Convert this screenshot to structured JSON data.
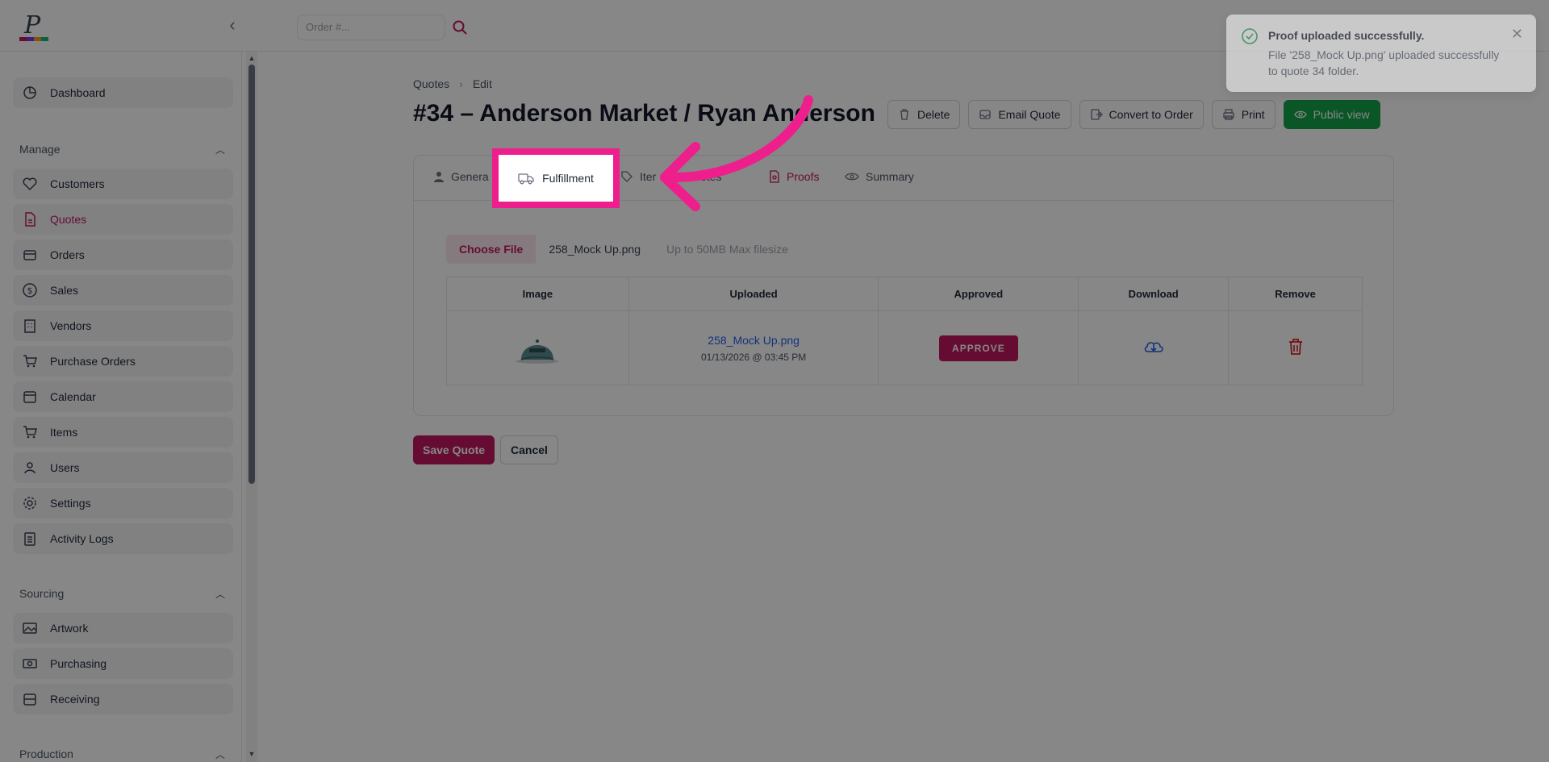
{
  "header": {
    "search_placeholder": "Order #..."
  },
  "sidebar": {
    "items_top": [
      {
        "label": "Dashboard",
        "icon": "dashboard-icon"
      }
    ],
    "manage_section": "Manage",
    "manage_items": [
      {
        "label": "Customers",
        "icon": "heart-icon"
      },
      {
        "label": "Quotes",
        "icon": "document-icon",
        "active": true
      },
      {
        "label": "Orders",
        "icon": "box-icon"
      },
      {
        "label": "Sales",
        "icon": "dollar-icon"
      },
      {
        "label": "Vendors",
        "icon": "building-icon"
      },
      {
        "label": "Purchase Orders",
        "icon": "cart-icon"
      },
      {
        "label": "Calendar",
        "icon": "calendar-icon"
      },
      {
        "label": "Items",
        "icon": "cart-icon"
      },
      {
        "label": "Users",
        "icon": "users-icon"
      },
      {
        "label": "Settings",
        "icon": "gear-icon"
      },
      {
        "label": "Activity Logs",
        "icon": "clipboard-icon"
      }
    ],
    "sourcing_section": "Sourcing",
    "sourcing_items": [
      {
        "label": "Artwork",
        "icon": "image-icon"
      },
      {
        "label": "Purchasing",
        "icon": "money-icon"
      },
      {
        "label": "Receiving",
        "icon": "inbox-icon"
      }
    ],
    "production_section": "Production"
  },
  "breadcrumb": {
    "parent": "Quotes",
    "current": "Edit"
  },
  "page_title": "#34 – Anderson Market / Ryan Anderson",
  "actions": {
    "delete": "Delete",
    "email_quote": "Email Quote",
    "convert_to_order": "Convert to Order",
    "print": "Print",
    "public_view": "Public view"
  },
  "tabs": {
    "general": "Genera",
    "fulfillment": "Fulfillment",
    "items": "Iter",
    "quotes": "otes",
    "proofs": "Proofs",
    "summary": "Summary"
  },
  "file_upload": {
    "choose_label": "Choose File",
    "file_name": "258_Mock Up.png",
    "hint": "Up to 50MB Max filesize"
  },
  "proofs_table": {
    "headers": [
      "Image",
      "Uploaded",
      "Approved",
      "Download",
      "Remove"
    ],
    "rows": [
      {
        "file_name": "258_Mock Up.png",
        "uploaded_at": "01/13/2026 @ 03:45 PM",
        "approve_label": "APPROVE"
      }
    ]
  },
  "footer_actions": {
    "save": "Save Quote",
    "cancel": "Cancel"
  },
  "toast": {
    "title": "Proof uploaded successfully.",
    "body": "File '258_Mock Up.png' uploaded successfully to quote 34 folder."
  },
  "highlight_label": "Fulfillment",
  "colors": {
    "accent": "#c0185f",
    "highlight": "#ee1f8c",
    "green": "#16a34a",
    "link": "#2563eb"
  }
}
